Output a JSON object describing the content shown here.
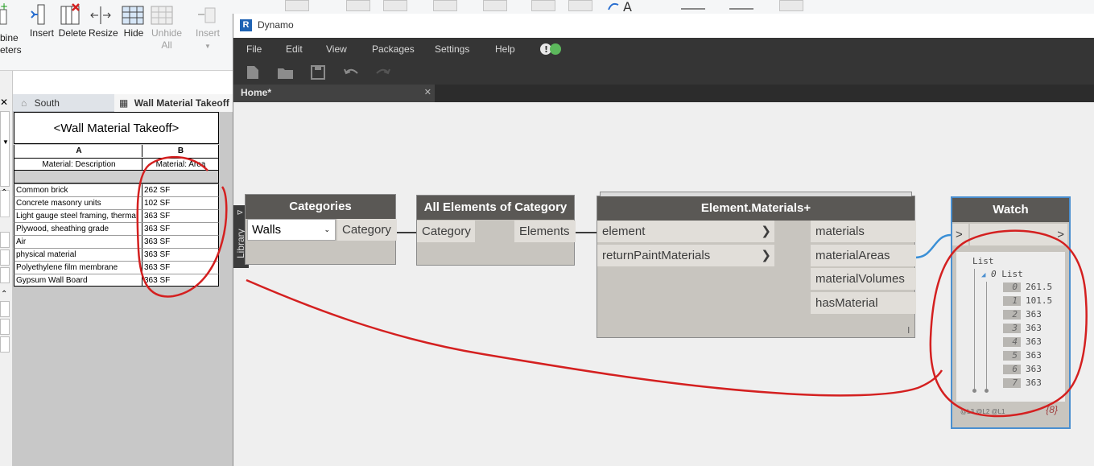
{
  "revit": {
    "ribbon": {
      "partial_label_top": "bine",
      "partial_label_bottom": "eters",
      "buttons": [
        {
          "label": "Insert"
        },
        {
          "label": "Delete"
        },
        {
          "label": "Resize"
        },
        {
          "label": "Hide"
        },
        {
          "label": "Unhide",
          "label2": "All"
        },
        {
          "label": "Insert"
        }
      ]
    },
    "view_tabs": [
      {
        "label": "South"
      },
      {
        "label": "Wall Material Takeoff"
      }
    ],
    "schedule": {
      "title": "<Wall Material Takeoff>",
      "column_letters": [
        "A",
        "B"
      ],
      "column_headers": [
        "Material: Description",
        "Material: Area"
      ],
      "rows": [
        {
          "description": "Common brick",
          "area": "262 SF"
        },
        {
          "description": "Concrete masonry units",
          "area": "102 SF"
        },
        {
          "description": "Light gauge steel framing, thermal",
          "area": "363 SF"
        },
        {
          "description": "Plywood, sheathing grade",
          "area": "363 SF"
        },
        {
          "description": "Air",
          "area": "363 SF"
        },
        {
          "description": "physical material",
          "area": "363 SF"
        },
        {
          "description": "Polyethylene film membrane",
          "area": "363 SF"
        },
        {
          "description": "Gypsum Wall Board",
          "area": "363 SF"
        }
      ]
    }
  },
  "dynamo": {
    "window_title": "Dynamo",
    "app_letter": "R",
    "menu": [
      "File",
      "Edit",
      "View",
      "Packages",
      "Settings",
      "Help"
    ],
    "tab": {
      "label": "Home*",
      "close": "✕"
    },
    "library_label": "Library",
    "nodes": {
      "categories": {
        "title": "Categories",
        "dropdown_value": "Walls",
        "output": "Category"
      },
      "all_elements": {
        "title": "All Elements of Category",
        "input": "Category",
        "output": "Elements"
      },
      "element_materials": {
        "title": "Element.Materials+",
        "inputs": [
          "element",
          "returnPaintMaterials"
        ],
        "outputs": [
          "materials",
          "materialAreas",
          "materialVolumes",
          "hasMaterial"
        ],
        "lacing": "l"
      },
      "watch": {
        "title": "Watch",
        "in_port": ">",
        "out_port": ">",
        "root_label": "List",
        "sub_index": "0",
        "sub_label": "List",
        "items": [
          {
            "index": "0",
            "value": "261.5"
          },
          {
            "index": "1",
            "value": "101.5"
          },
          {
            "index": "2",
            "value": "363"
          },
          {
            "index": "3",
            "value": "363"
          },
          {
            "index": "4",
            "value": "363"
          },
          {
            "index": "5",
            "value": "363"
          },
          {
            "index": "6",
            "value": "363"
          },
          {
            "index": "7",
            "value": "363"
          }
        ],
        "levels": "@L3 @L2 @L1",
        "count": "{8}"
      }
    }
  },
  "colors": {
    "annotation_red": "#d42020",
    "wire_blue": "#3a8fd6",
    "watch_border": "#4a8fd0"
  }
}
